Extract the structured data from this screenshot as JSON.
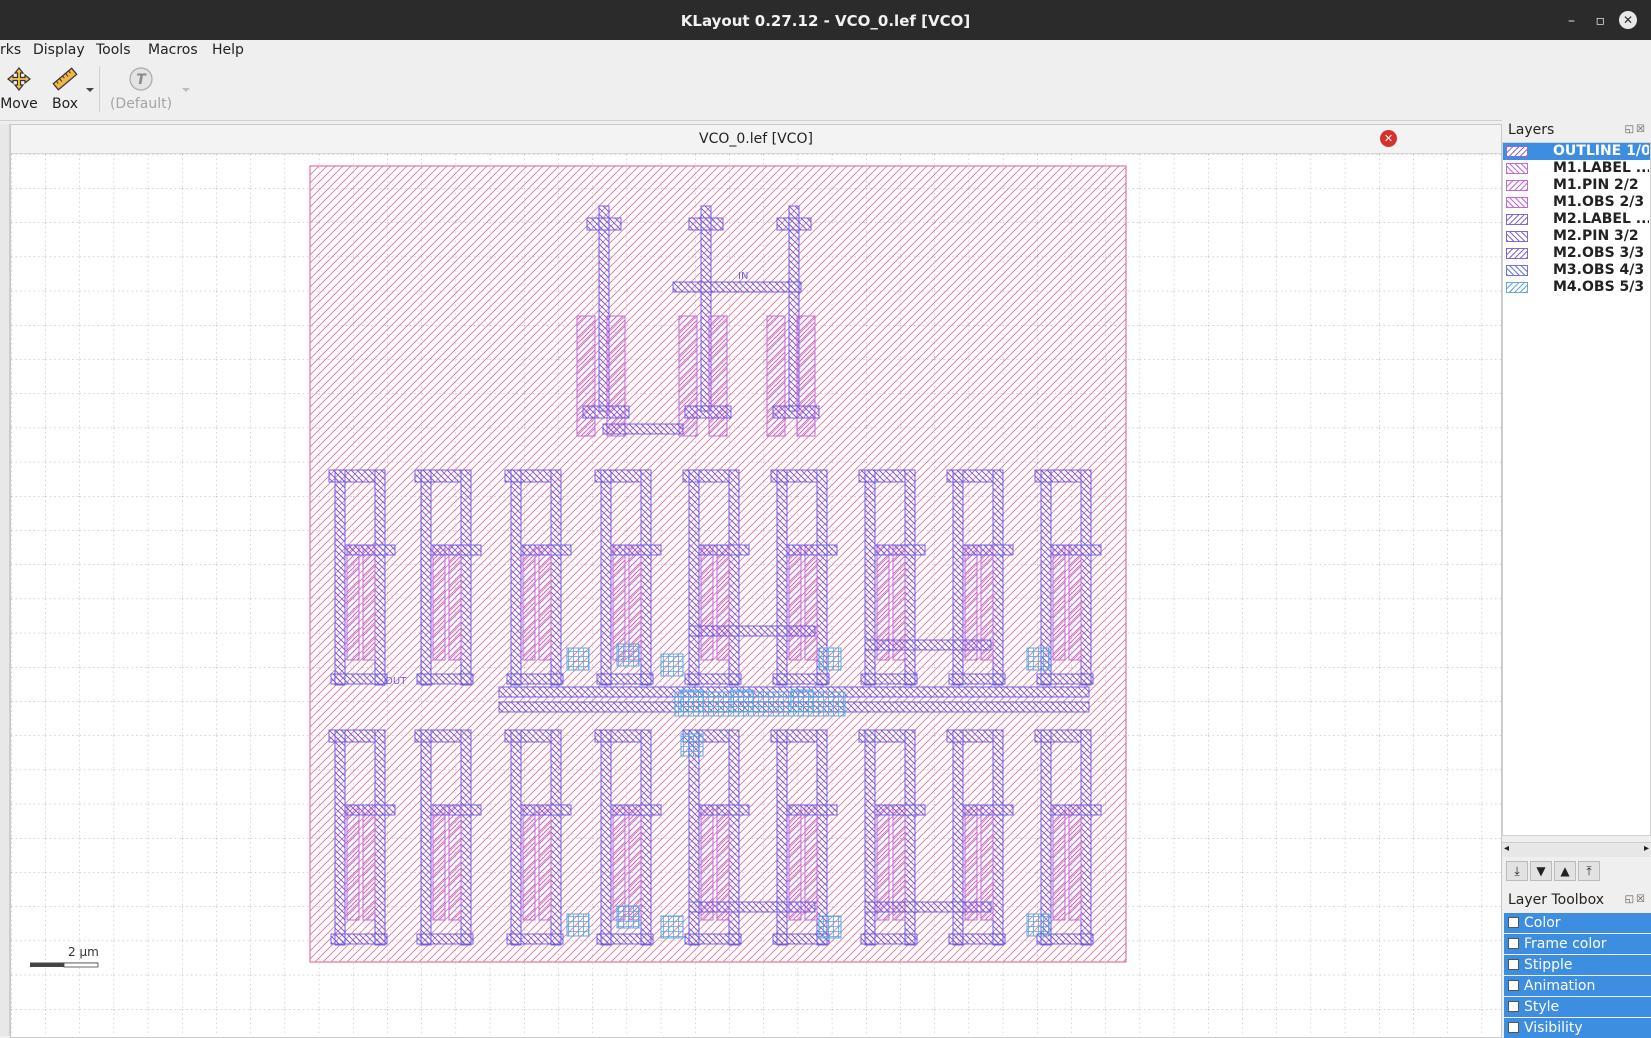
{
  "window": {
    "title": "KLayout 0.27.12 - VCO_0.lef [VCO]",
    "controls": [
      "–",
      "▫",
      "✕"
    ]
  },
  "menu": {
    "items": [
      "rks",
      "Display",
      "Tools",
      "Macros",
      "Help"
    ]
  },
  "toolbar": {
    "move_label": "Move",
    "box_label": "Box",
    "text_label": "(Default)"
  },
  "canvas": {
    "tab_title": "VCO_0.lef [VCO]",
    "scale_label": "2  µm",
    "pin_labels": {
      "in": "IN",
      "out": "OUT"
    }
  },
  "layers_panel": {
    "title": "Layers",
    "layers": [
      {
        "name": "OUTLINE 1/0",
        "selected": true,
        "color": "#8a6bdc"
      },
      {
        "name": "M1.LABEL ...",
        "selected": false,
        "color": "#c46ad8"
      },
      {
        "name": "M1.PIN 2/2",
        "selected": false,
        "color": "#c46ad8"
      },
      {
        "name": "M1.OBS 2/3",
        "selected": false,
        "color": "#c46ad8"
      },
      {
        "name": "M2.LABEL ...",
        "selected": false,
        "color": "#7a6ae0"
      },
      {
        "name": "M2.PIN 3/2",
        "selected": false,
        "color": "#7a6ae0"
      },
      {
        "name": "M2.OBS 3/3",
        "selected": false,
        "color": "#7a6ae0"
      },
      {
        "name": "M3.OBS 4/3",
        "selected": false,
        "color": "#6a7ae0"
      },
      {
        "name": "M4.OBS 5/3",
        "selected": false,
        "color": "#6aa8e0"
      }
    ]
  },
  "layer_toolbox": {
    "title": "Layer Toolbox",
    "items": [
      "Color",
      "Frame color",
      "Stipple",
      "Animation",
      "Style",
      "Visibility"
    ]
  },
  "colors": {
    "outline": "#e0609a",
    "m1": "#c26ad6",
    "m2": "#7060e0",
    "m3": "#58a8e0",
    "selection": "#3d8ee0"
  }
}
